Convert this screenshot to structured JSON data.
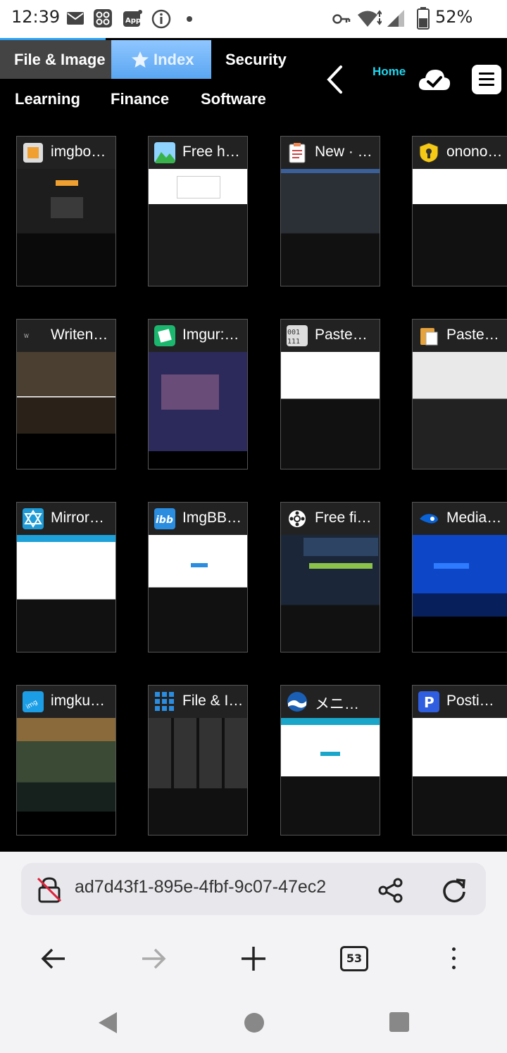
{
  "status_bar": {
    "time": "12:39",
    "battery": "52%",
    "icons": [
      "mail-icon",
      "app-grid-icon",
      "app-badge-icon",
      "info-icon",
      "dot-icon",
      "vpn-key-icon",
      "wifi-icon",
      "signal-icon",
      "battery-icon"
    ],
    "app_badge_text": "App"
  },
  "nav": {
    "tabs_row1": [
      "File & Image",
      "Index",
      "Security"
    ],
    "tabs_row2": [
      "Learning",
      "Finance",
      "Software"
    ],
    "home_label": "Home",
    "active_tab": "Index"
  },
  "tiles": [
    {
      "title": "imgbo…",
      "fav_color": "#f0a030",
      "fav_icon": "imgbox-icon",
      "shot_bg": "#1d1d1d"
    },
    {
      "title": "Free h…",
      "fav_color": "#38b24a",
      "fav_icon": "mountain-image-icon",
      "shot_bg": "#ffffff"
    },
    {
      "title": "New · …",
      "fav_color": "#f4f4f4",
      "fav_icon": "clipboard-icon",
      "shot_bg": "#2b2f36"
    },
    {
      "title": "onono…",
      "fav_color": "#f6c915",
      "fav_icon": "keyhole-icon",
      "shot_bg": "#ffffff"
    },
    {
      "title": "Writen…",
      "fav_color": "#222222",
      "fav_icon": "writening-icon",
      "shot_bg": "#3a3228"
    },
    {
      "title": "Imgur:…",
      "fav_color": "#1bb76e",
      "fav_icon": "imgur-icon",
      "shot_bg": "#2c2a5a"
    },
    {
      "title": "Paste…",
      "fav_color": "#dddddd",
      "fav_icon": "binary-icon",
      "shot_bg": "#ffffff"
    },
    {
      "title": "Paste…",
      "fav_color": "#e6a23c",
      "fav_icon": "clipboard-paste-icon",
      "shot_bg": "#e9e9e9"
    },
    {
      "title": "Mirror…",
      "fav_color": "#1e9bd7",
      "fav_icon": "mirrored-icon",
      "shot_bg": "#ffffff"
    },
    {
      "title": "ImgBB…",
      "fav_color": "#2a8de0",
      "fav_icon": "ibb-icon",
      "shot_bg": "#ffffff"
    },
    {
      "title": "Free fi…",
      "fav_color": "#ffffff",
      "fav_icon": "pixeldrain-icon",
      "shot_bg": "#121a2a"
    },
    {
      "title": "Media…",
      "fav_color": "#0a63d6",
      "fav_icon": "mediafire-icon",
      "shot_bg": "#0d47c8"
    },
    {
      "title": "imgku…",
      "fav_color": "#1c9ee6",
      "fav_icon": "imgkub-icon",
      "shot_bg": "#3a4a34"
    },
    {
      "title": "File & I…",
      "fav_color": "#2a8de0",
      "fav_icon": "dots-grid-icon",
      "shot_bg": "#1a1a1a"
    },
    {
      "title": "メニ…",
      "fav_color": "#1a5fb4",
      "fav_icon": "wave-logo-icon",
      "shot_bg": "#ffffff"
    },
    {
      "title": "Posti…",
      "fav_color": "#2f5fe0",
      "fav_icon": "postimage-icon",
      "shot_bg": "#ffffff"
    }
  ],
  "url_bar": {
    "url": "ad7d43f1-895e-4fbf-9c07-47ec2"
  },
  "toolbar": {
    "tab_count": "53"
  }
}
